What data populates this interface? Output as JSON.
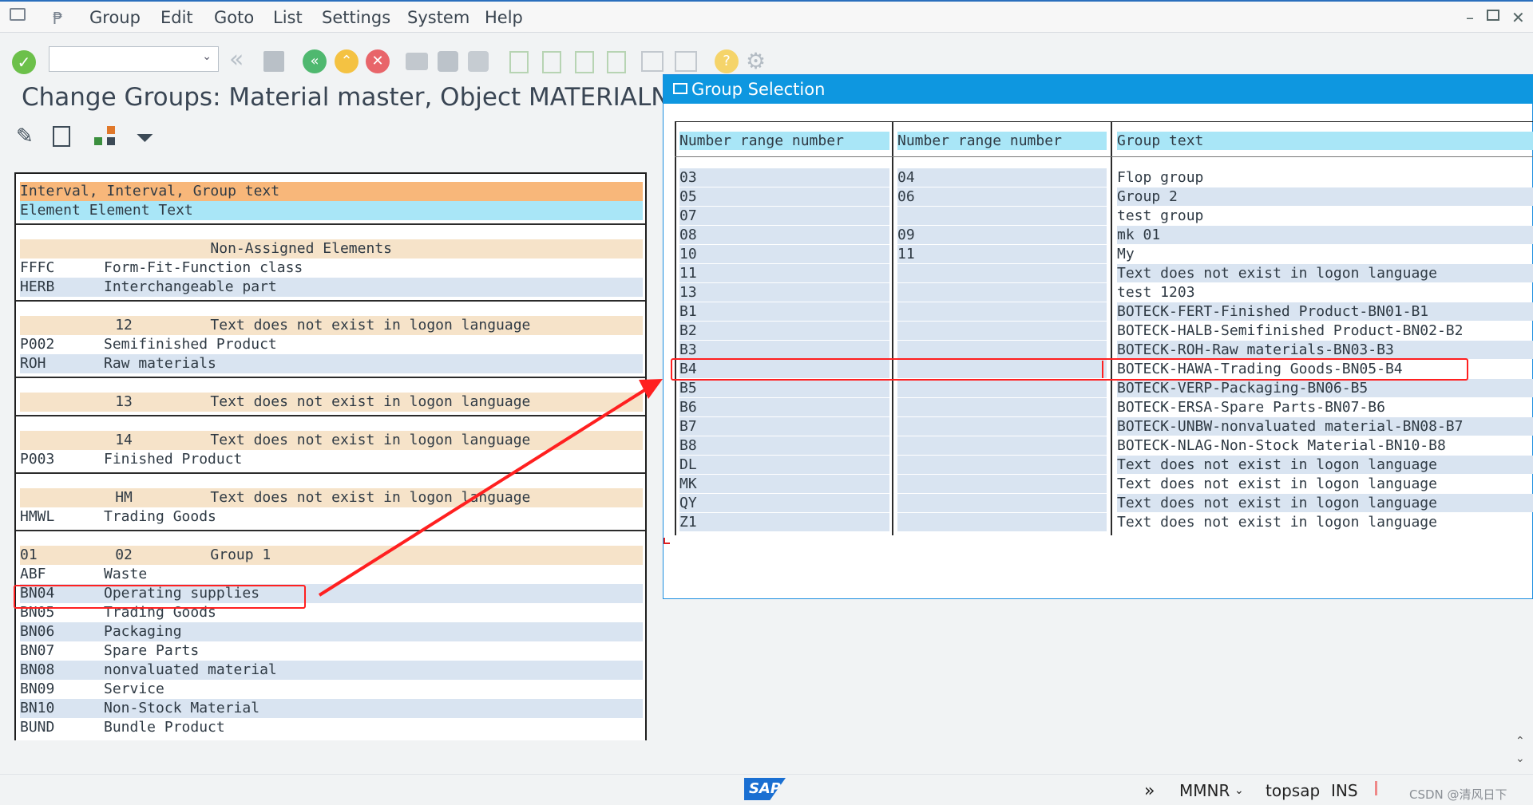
{
  "menu": {
    "items": [
      "Group",
      "Edit",
      "Goto",
      "List",
      "Settings",
      "System",
      "Help"
    ]
  },
  "page": {
    "title": "Change Groups: Material master, Object MATERIALNR"
  },
  "left_list": {
    "header_row1": "Interval, Interval, Group text",
    "header_row2": "Element Element Text",
    "groups": [
      {
        "header": "                      Non-Assigned Elements",
        "rows": [
          [
            "FFFC",
            "Form-Fit-Function class"
          ],
          [
            "HERB",
            "Interchangeable part"
          ]
        ]
      },
      {
        "header": "           12         Text does not exist in logon language",
        "rows": [
          [
            "P002",
            "Semifinished Product"
          ],
          [
            "ROH",
            "Raw materials"
          ]
        ]
      },
      {
        "header": "           13         Text does not exist in logon language",
        "rows": []
      },
      {
        "header": "           14         Text does not exist in logon language",
        "rows": [
          [
            "P003",
            "Finished Product"
          ]
        ]
      },
      {
        "header": "           HM         Text does not exist in logon language",
        "rows": [
          [
            "HMWL",
            "Trading Goods"
          ]
        ]
      },
      {
        "header": "01         02         Group 1",
        "rows": [
          [
            "ABF",
            "Waste"
          ],
          [
            "BN04",
            "Operating supplies"
          ],
          [
            "BN05",
            "Trading Goods"
          ],
          [
            "BN06",
            "Packaging"
          ],
          [
            "BN07",
            "Spare Parts"
          ],
          [
            "BN08",
            "nonvaluated material"
          ],
          [
            "BN09",
            "Service"
          ],
          [
            "BN10",
            "Non-Stock Material"
          ],
          [
            "BUND",
            "Bundle Product"
          ]
        ]
      }
    ]
  },
  "popup": {
    "title": "Group Selection",
    "columns": [
      "Number range number",
      "Number range number",
      "Group text"
    ],
    "rows": [
      [
        "03",
        "04",
        "Flop group"
      ],
      [
        "05",
        "06",
        "Group 2"
      ],
      [
        "07",
        "",
        "test group"
      ],
      [
        "08",
        "09",
        "mk 01"
      ],
      [
        "10",
        "11",
        "My"
      ],
      [
        "11",
        "",
        "Text does not exist in logon language"
      ],
      [
        "13",
        "",
        "test 1203"
      ],
      [
        "B1",
        "",
        "BOTECK-FERT-Finished Product-BN01-B1"
      ],
      [
        "B2",
        "",
        "BOTECK-HALB-Semifinished Product-BN02-B2"
      ],
      [
        "B3",
        "",
        "BOTECK-ROH-Raw materials-BN03-B3"
      ],
      [
        "B4",
        "",
        "BOTECK-HAWA-Trading Goods-BN05-B4"
      ],
      [
        "B5",
        "",
        "BOTECK-VERP-Packaging-BN06-B5"
      ],
      [
        "B6",
        "",
        "BOTECK-ERSA-Spare Parts-BN07-B6"
      ],
      [
        "B7",
        "",
        "BOTECK-UNBW-nonvaluated material-BN08-B7"
      ],
      [
        "B8",
        "",
        "BOTECK-NLAG-Non-Stock Material-BN10-B8"
      ],
      [
        "DL",
        "",
        "Text does not exist in logon language"
      ],
      [
        "MK",
        "",
        "Text does not exist in logon language"
      ],
      [
        "QY",
        "",
        "Text does not exist in logon language"
      ],
      [
        "Z1",
        "",
        "Text does not exist in logon language"
      ]
    ]
  },
  "status": {
    "sap_logo": "SAP",
    "transaction": "MMNR",
    "system": "topsap",
    "mode": "INS",
    "watermark": "CSDN @清风日下"
  },
  "colors": {
    "header_orange": "#f8b77a",
    "header_cyan": "#a9e6f7",
    "group_beige": "#f6e3c9",
    "row_blue": "#d9e4f1",
    "popup_title": "#0e97e0",
    "annotation_red": "#ff2020"
  }
}
